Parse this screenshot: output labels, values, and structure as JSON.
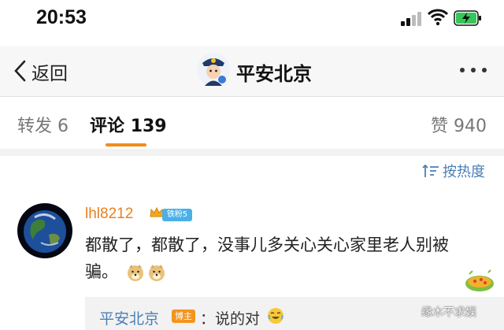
{
  "status_bar": {
    "time": "20:53"
  },
  "nav": {
    "back_label": "返回",
    "title": "平安北京"
  },
  "tabs": [
    {
      "label": "转发",
      "count": "6"
    },
    {
      "label": "评论",
      "count": "139"
    },
    {
      "label": "赞",
      "count": "940"
    }
  ],
  "sort": {
    "label": "按热度"
  },
  "comment": {
    "username": "lhl8212",
    "fan_badge": "铁粉5",
    "text": "都散了，都散了，没事儿多关心关心家里老人别被骗。",
    "reply": {
      "author": "平安北京",
      "badge": "博主",
      "text": "：说的对"
    }
  },
  "watermark": "缘木不求娱",
  "colors": {
    "accent": "#f28b1a",
    "link": "#4a7fb5",
    "username": "#e8801e"
  }
}
